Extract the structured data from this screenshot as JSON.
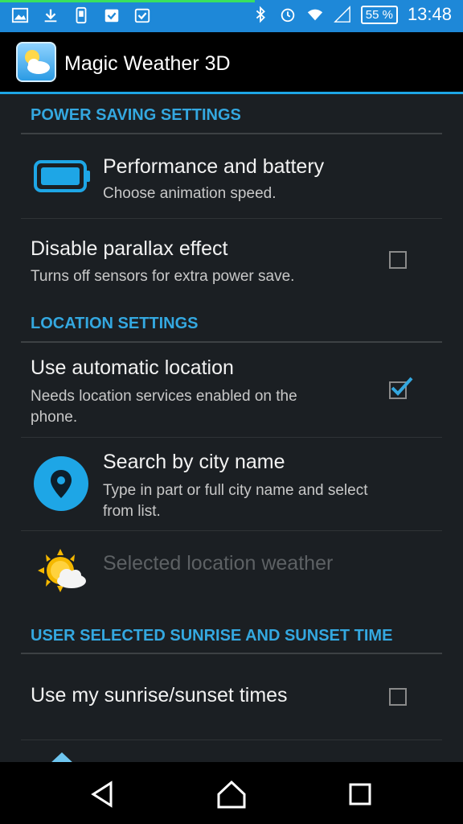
{
  "status_bar": {
    "battery": "55 %",
    "time": "13:48",
    "icons": [
      "gallery-icon",
      "download-icon",
      "usb-icon",
      "task-done-icon",
      "task-done-icon",
      "bluetooth-icon",
      "alarm-icon",
      "wifi-icon",
      "signal-icon",
      "battery-icon"
    ],
    "progress_fraction": 0.55
  },
  "app_bar": {
    "title": "Magic Weather 3D",
    "logo": "weather-app-icon"
  },
  "sections": {
    "power": {
      "header": "POWER SAVING SETTINGS",
      "performance": {
        "title": "Performance and battery",
        "subtitle": "Choose animation speed.",
        "icon": "battery-icon"
      },
      "parallax": {
        "title": "Disable parallax effect",
        "subtitle": "Turns off sensors for extra power save.",
        "checked": false
      }
    },
    "location": {
      "header": "LOCATION SETTINGS",
      "automatic": {
        "title": "Use automatic location",
        "subtitle_line1": "Needs location services enabled on the",
        "subtitle_line2": "phone.",
        "checked": true
      },
      "search": {
        "title": "Search by city name",
        "subtitle_line1": "Type in part or full city name and select",
        "subtitle_line2": "from list.",
        "icon": "location-pin-icon"
      },
      "selected": {
        "title": "Selected location weather",
        "icon": "sun-cloud-icon",
        "enabled": false
      }
    },
    "sunrise": {
      "header": "USER SELECTED SUNRISE AND SUNSET TIME",
      "use_my_times": {
        "title": "Use my sunrise/sunset times",
        "checked": false
      }
    }
  },
  "colors": {
    "status_bar": "#1e88d8",
    "accent": "#1ea6e6",
    "background": "#1b1f23"
  },
  "nav_bar": {
    "buttons": [
      "back-icon",
      "home-icon",
      "recents-icon"
    ]
  }
}
